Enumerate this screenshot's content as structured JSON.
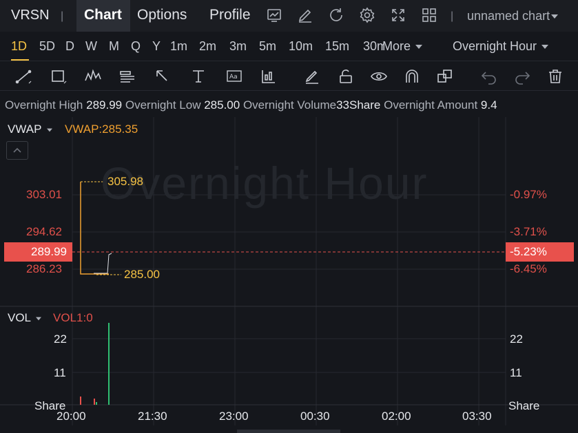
{
  "header": {
    "ticker": "VRSN",
    "tabs": [
      "Chart",
      "Options",
      "Profile"
    ],
    "layout_name": "unnamed chart",
    "icons": [
      "chart-icon",
      "edit-icon",
      "refresh-icon",
      "settings-icon",
      "expand-icon",
      "grid-icon"
    ]
  },
  "intervals": {
    "items": [
      "1D",
      "5D",
      "D",
      "W",
      "M",
      "Q",
      "Y",
      "1m",
      "2m",
      "3m",
      "5m",
      "10m",
      "15m",
      "30m"
    ],
    "active": "1D",
    "more_label": "More",
    "session": "Overnight Hour"
  },
  "drawing_tools": [
    "trendline",
    "rectangle",
    "pattern",
    "text-note",
    "arrow",
    "price-range",
    "text-box",
    "indicator",
    "pen",
    "lock",
    "visibility",
    "magnet",
    "group",
    "undo",
    "redo",
    "delete"
  ],
  "stats": {
    "high_label": "Overnight High",
    "high": "289.99",
    "low_label": "Overnight Low",
    "low": "285.00",
    "volume_label": "Overnight Volume",
    "volume": "33Share",
    "amount_label": "Overnight Amount",
    "amount": "9.4"
  },
  "price_panel": {
    "indicator": "VWAP",
    "indicator_value": "VWAP:285.35",
    "watermark": "Overnight Hour",
    "left_ticks": [
      "303.01",
      "294.62",
      "286.23"
    ],
    "right_ticks": [
      "-0.97%",
      "-3.71%",
      "-6.45%"
    ],
    "current_price": "289.99",
    "current_pct": "-5.23%",
    "high_marker": "305.98",
    "low_marker": "285.00"
  },
  "volume_panel": {
    "label": "VOL",
    "value": "VOL1:0",
    "ticks": [
      "22",
      "11"
    ],
    "unit": "Share"
  },
  "time_axis": [
    "20:00",
    "21:30",
    "23:00",
    "00:30",
    "02:00",
    "03:30"
  ],
  "colors": {
    "background": "#15171c",
    "accent": "#f6c344",
    "down": "#e8514c",
    "up": "#2fbf71",
    "vwap": "#f0a030"
  }
}
